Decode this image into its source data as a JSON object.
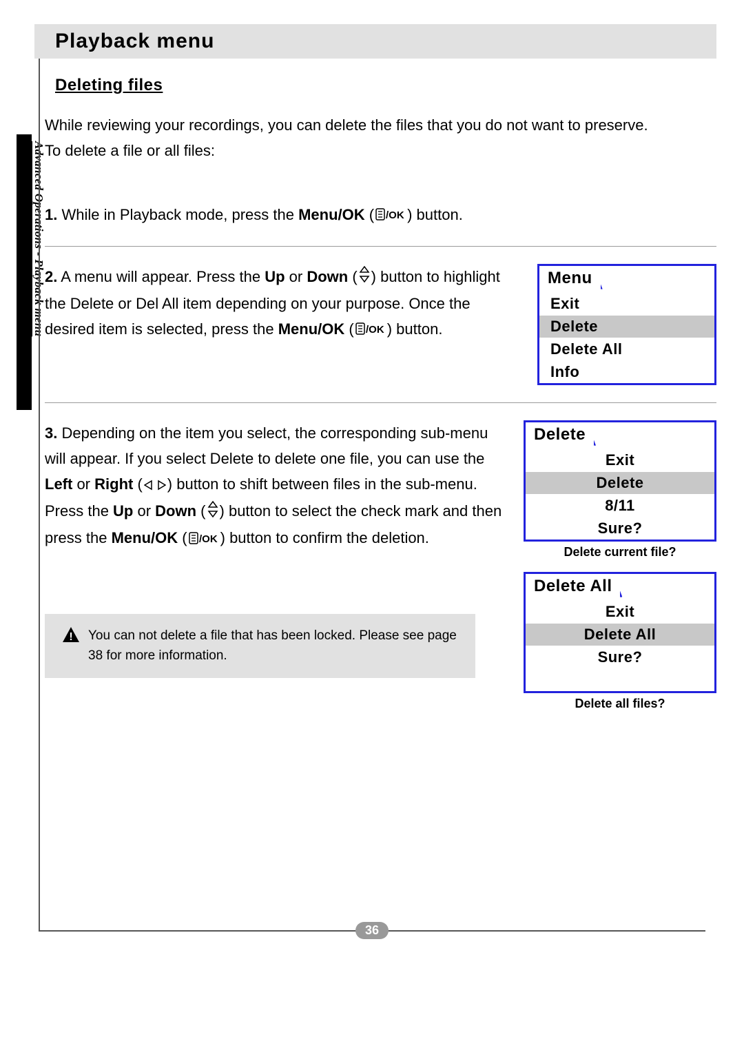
{
  "header": {
    "title": "Playback menu"
  },
  "section": {
    "title": "Deleting files"
  },
  "side_text": "Advanced Operations - Playback menu",
  "intro": {
    "p1": "While reviewing your recordings, you can delete the files that you do not want to preserve.",
    "p2": "To delete a file or all files:"
  },
  "steps": {
    "s1": {
      "num": "1.",
      "t1": "While in Playback mode, press the ",
      "b1": "Menu/OK",
      "t2": " (",
      "t3": ") button."
    },
    "s2": {
      "num": "2.",
      "t1": "A menu will appear. Press the ",
      "b1": "Up",
      "t2": " or ",
      "b2": "Down",
      "t3": " (",
      "t4": ") button to highlight the Delete or Del All item depending on your purpose. Once the desired item is selected, press the ",
      "b3": "Menu/OK",
      "t5": " (",
      "t6": ") button."
    },
    "s3": {
      "num": "3.",
      "t1": "Depending on the item you select, the corresponding sub-menu will appear. If you select Delete to delete one file, you can use the ",
      "b1": "Left",
      "t2": " or ",
      "b2": "Right",
      "t3": " (",
      "t4": ") button to shift between files in the sub-menu. Press the ",
      "b3": "Up",
      "t5": " or ",
      "b4": "Down",
      "t6": " (",
      "t7": ") button to select the check mark and then press the ",
      "b5": "Menu/OK",
      "t8": " (",
      "t9": ") button to confirm the deletion."
    }
  },
  "menus": {
    "m1": {
      "title": "Menu",
      "items": [
        "Exit",
        "Delete",
        "Delete All",
        "Info"
      ],
      "highlight_index": 1
    },
    "m2": {
      "title": "Delete",
      "items": [
        "Exit",
        "Delete",
        "8/11",
        "Sure?"
      ],
      "highlight_index": 1,
      "caption": "Delete current file?"
    },
    "m3": {
      "title": "Delete All",
      "items": [
        "Exit",
        "Delete All",
        "Sure?"
      ],
      "highlight_index": 1,
      "caption": "Delete all files?"
    }
  },
  "note": {
    "text": "You can not delete a file that has been locked. Please see page 38 for more information."
  },
  "page_number": "36"
}
